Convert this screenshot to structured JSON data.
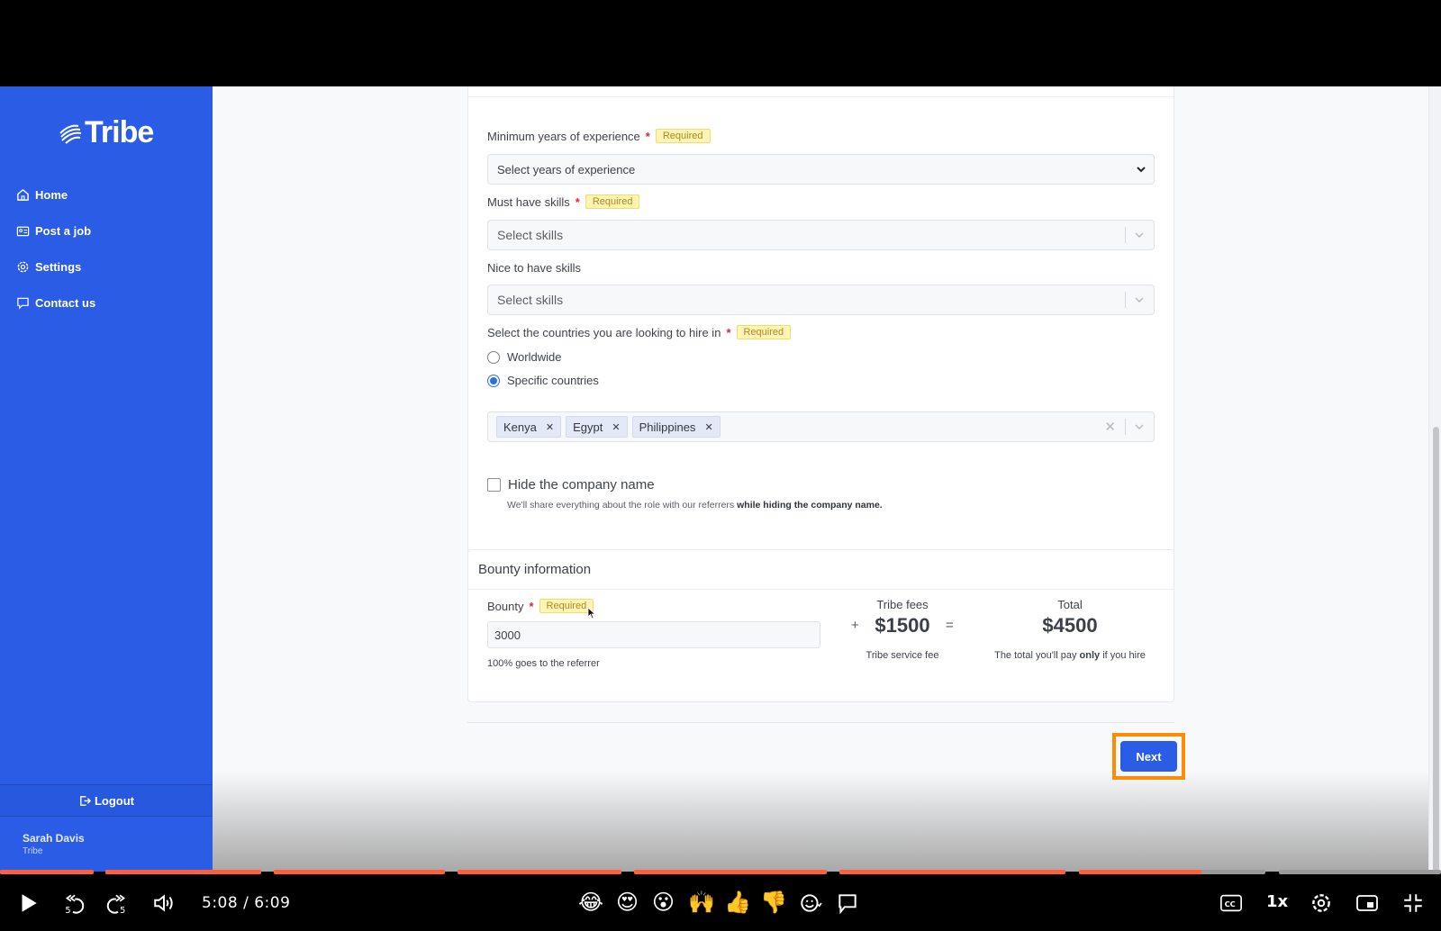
{
  "sidebar": {
    "logo_text": "Tribe",
    "nav": [
      {
        "label": "Home",
        "icon": "home-icon"
      },
      {
        "label": "Post a job",
        "icon": "id-card-icon"
      },
      {
        "label": "Settings",
        "icon": "gear-icon"
      },
      {
        "label": "Contact us",
        "icon": "chat-icon"
      }
    ],
    "logout_label": "Logout",
    "user": {
      "name": "Sarah Davis",
      "org": "Tribe"
    }
  },
  "form": {
    "experience": {
      "label": "Minimum years of experience",
      "required_badge": "Required",
      "placeholder": "Select years of experience"
    },
    "must_skills": {
      "label": "Must have skills",
      "required_badge": "Required",
      "placeholder": "Select skills"
    },
    "nice_skills": {
      "label": "Nice to have skills",
      "placeholder": "Select skills"
    },
    "countries": {
      "label": "Select the countries you are looking to hire in",
      "required_badge": "Required",
      "options": [
        {
          "label": "Worldwide",
          "selected": false
        },
        {
          "label": "Specific countries",
          "selected": true
        }
      ],
      "selected_countries": [
        "Kenya",
        "Egypt",
        "Philippines"
      ]
    },
    "hide_company": {
      "label": "Hide the company name",
      "checked": false,
      "hint_prefix": "We'll share everything about the role with our referrers ",
      "hint_bold": "while hiding the company name."
    }
  },
  "bounty": {
    "section_title": "Bounty information",
    "label": "Bounty",
    "required_badge": "Required",
    "value": "3000",
    "note": "100% goes to the referrer",
    "plus": "+",
    "equals": "=",
    "fees_label": "Tribe fees",
    "fees_amount": "$1500",
    "fees_sub": "Tribe service fee",
    "total_label": "Total",
    "total_amount": "$4500",
    "total_sub_prefix": "The total you'll pay ",
    "total_sub_bold": "only",
    "total_sub_suffix": " if you hire"
  },
  "actions": {
    "next_label": "Next",
    "highlight_color": "#ff8c00"
  },
  "colors": {
    "brand": "#2a5ce6",
    "required_star": "#e0233a",
    "badge_bg": "#fdf4b5",
    "progress": "#ff5f3a"
  },
  "video": {
    "current_time": "5:08",
    "separator": "/",
    "duration": "6:09",
    "progress_fraction": 0.834,
    "speed": "1x",
    "reactions": [
      "😂",
      "😍",
      "😮",
      "🙌",
      "👍",
      "👎"
    ]
  }
}
